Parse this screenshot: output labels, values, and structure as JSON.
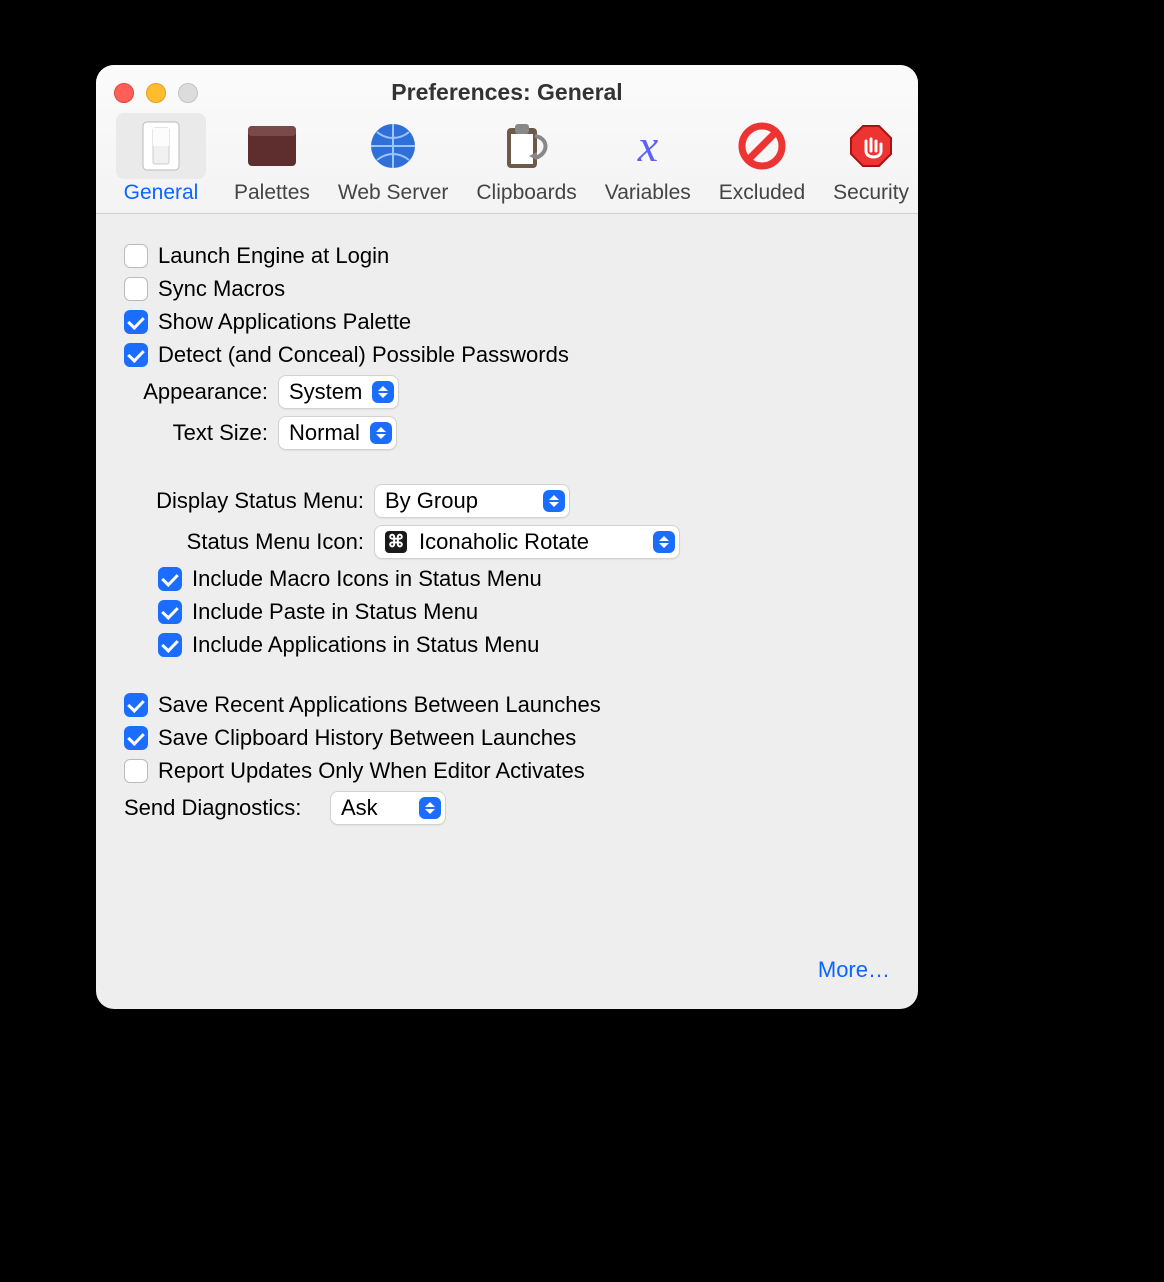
{
  "window": {
    "title": "Preferences: General"
  },
  "tabs": {
    "general": "General",
    "palettes": "Palettes",
    "webserver": "Web Server",
    "clipboards": "Clipboards",
    "variables": "Variables",
    "excluded": "Excluded",
    "security": "Security"
  },
  "checks": {
    "launch_engine": "Launch Engine at Login",
    "sync_macros": "Sync Macros",
    "show_app_palette": "Show Applications Palette",
    "detect_passwords": "Detect (and Conceal) Possible Passwords",
    "include_macro_icons": "Include Macro Icons in Status Menu",
    "include_paste": "Include Paste in Status Menu",
    "include_apps": "Include Applications in Status Menu",
    "save_recent_apps": "Save Recent Applications Between Launches",
    "save_clipboard_hist": "Save Clipboard History Between Launches",
    "report_updates": "Report Updates Only When Editor Activates"
  },
  "labels": {
    "appearance": "Appearance:",
    "text_size": "Text Size:",
    "display_status": "Display Status Menu:",
    "status_icon": "Status Menu Icon:",
    "send_diagnostics": "Send Diagnostics:"
  },
  "selects": {
    "appearance": "System",
    "text_size": "Normal",
    "display_status": "By Group",
    "status_icon": "Iconaholic Rotate",
    "send_diagnostics": "Ask"
  },
  "glyphs": {
    "cmd": "⌘"
  },
  "buttons": {
    "more": "More…"
  }
}
